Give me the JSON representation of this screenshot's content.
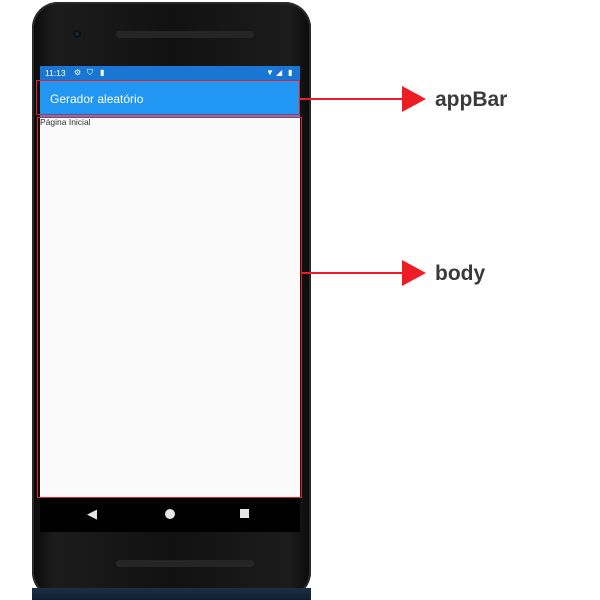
{
  "status_bar": {
    "time": "11:13",
    "icons_left": [
      "gear-icon",
      "shield-icon",
      "sd-card-icon"
    ],
    "icons_right": [
      "wifi-icon",
      "signal-icon",
      "battery-icon"
    ]
  },
  "app_bar": {
    "title": "Gerador aleatório"
  },
  "body": {
    "text": "Página Inicial"
  },
  "nav_bar": {
    "buttons": [
      "back",
      "home",
      "recents"
    ]
  },
  "annotations": {
    "appbar_label": "appBar",
    "body_label": "body",
    "color": "#ee1c25"
  },
  "colors": {
    "app_bar": "#2196f3",
    "status_bar": "#1976d2",
    "screen_background": "#fafafa",
    "annotation": "#ee1c25"
  }
}
